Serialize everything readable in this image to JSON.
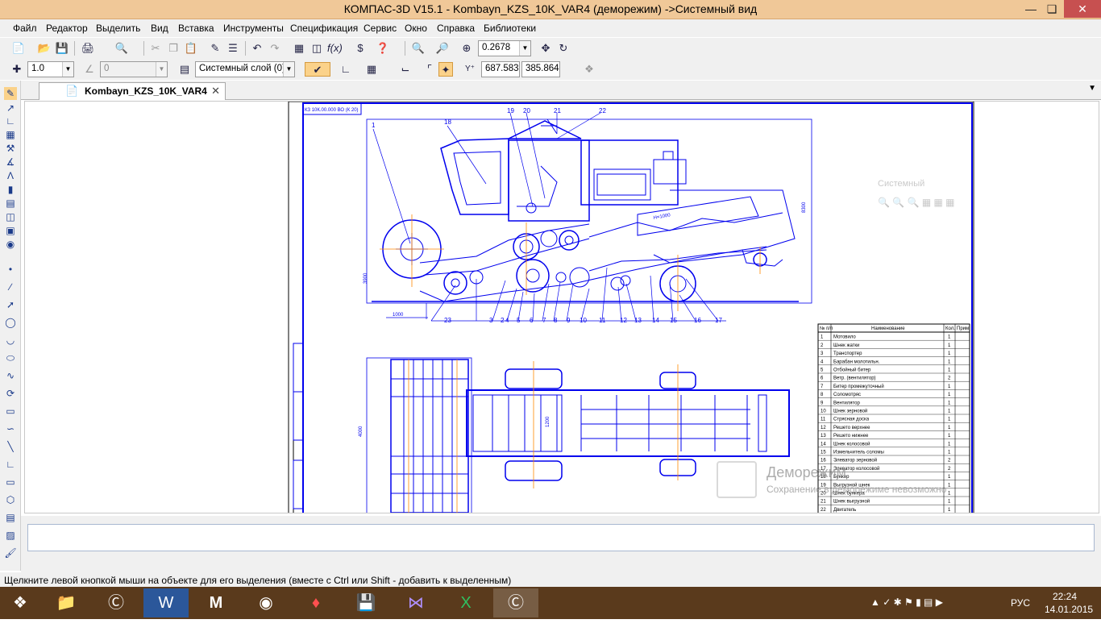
{
  "window": {
    "title": "КОМПАС-3D V15.1 - Kombayn_KZS_10K_VAR4 (деморежим) ->Системный вид"
  },
  "menu": [
    "Файл",
    "Редактор",
    "Выделить",
    "Вид",
    "Вставка",
    "Инструменты",
    "Спецификация",
    "Сервис",
    "Окно",
    "Справка",
    "Библиотеки"
  ],
  "toolbar1": {
    "zoom_value": "0.2678"
  },
  "toolbar2": {
    "step_value": "1.0",
    "angle_value": "0",
    "layer_value": "Системный слой (0)",
    "coord_x": "687.583",
    "coord_y": "385.864"
  },
  "document": {
    "tab_label": "Kombayn_KZS_10K_VAR4",
    "stamp_text": "КЗ 10К.00.000 ВО (К 20)",
    "spec_header": [
      "№ п/п",
      "Наименование",
      "Кол.",
      "Прим."
    ],
    "spec_rows": [
      [
        "1",
        "Мотовило",
        "1"
      ],
      [
        "2",
        "Шнек жатки",
        "1"
      ],
      [
        "3",
        "Транспортер",
        "1"
      ],
      [
        "4",
        "Барабан молотильн.",
        "1"
      ],
      [
        "5",
        "Отбойный битер",
        "1"
      ],
      [
        "6",
        "Ветр. (вентилятор)",
        "2"
      ],
      [
        "7",
        "Битер промежуточный",
        "1"
      ],
      [
        "8",
        "Соломотряс",
        "1"
      ],
      [
        "9",
        "Вентилятор",
        "1"
      ],
      [
        "10",
        "Шнек зерновой",
        "1"
      ],
      [
        "11",
        "Стрясная доска",
        "1"
      ],
      [
        "12",
        "Решето верхнее",
        "1"
      ],
      [
        "13",
        "Решето нижнее",
        "1"
      ],
      [
        "14",
        "Шнек колосовой",
        "1"
      ],
      [
        "15",
        "Измельчитель соломы",
        "1"
      ],
      [
        "16",
        "Элеватор зерновой",
        "2"
      ],
      [
        "17",
        "Элеватор колосовой",
        "2"
      ],
      [
        "18",
        "Бункер",
        "1"
      ],
      [
        "19",
        "Выгрузной шнек",
        "1"
      ],
      [
        "20",
        "Шнек бункера",
        "1"
      ],
      [
        "21",
        "Шнек выгрузной",
        "1"
      ],
      [
        "22",
        "Двигатель",
        "1"
      ]
    ],
    "callouts": [
      "1",
      "2",
      "3",
      "4",
      "5",
      "6",
      "7",
      "8",
      "9",
      "10",
      "11",
      "12",
      "13",
      "14",
      "15",
      "16",
      "17",
      "18",
      "19",
      "20",
      "21",
      "22",
      "23"
    ],
    "dim_labels": [
      "8300",
      "3900",
      "1000",
      "H=1000",
      "4000",
      "1200"
    ],
    "view_combo": "Системный",
    "watermark_title": "Деморежим",
    "watermark_sub": "Сохранение в деморежиме невозможно"
  },
  "statusbar": {
    "hint": "Щелкните левой кнопкой мыши на объекте для его выделения (вместе с Ctrl или Shift - добавить к выделенным)"
  },
  "taskbar": {
    "lang": "РУС",
    "time": "22:24",
    "date": "14.01.2015"
  },
  "colors": {
    "titlebar": "#f0c898",
    "drawing": "#0000ee",
    "axis": "#ff8800",
    "taskbar": "#5a3a1c"
  }
}
